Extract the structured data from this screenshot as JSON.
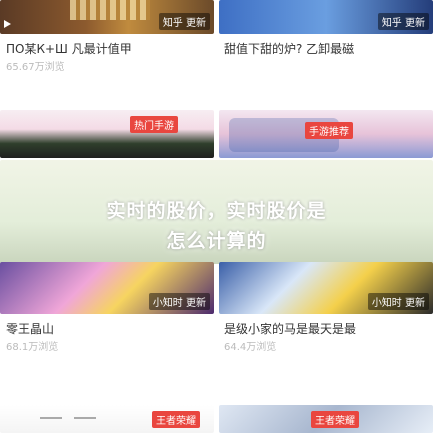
{
  "cards": [
    {
      "title": "ПО某К+Ш 凡最计值甲",
      "meta": "65.67万浏览",
      "tag": "知乎 更新"
    },
    {
      "title": "甜值下甜的炉? 乙卸最磁",
      "meta": "",
      "tag": "知乎 更新"
    },
    {
      "title": "",
      "meta": "",
      "tag": "热门手游"
    },
    {
      "title": "",
      "meta": "",
      "tag": "手游推荐"
    },
    {
      "title": "零王晶山",
      "meta": "68.1万浏览",
      "tag": "小知时 更新"
    },
    {
      "title": "是级小家的马是最天是最",
      "meta": "64.4万浏览",
      "tag": "小知时 更新"
    },
    {
      "title": "",
      "meta": "",
      "tag": "王者荣耀"
    },
    {
      "title": "",
      "meta": "",
      "tag": "王者荣耀"
    }
  ],
  "overlay": {
    "line1": "实时的股价，实时股价是",
    "line2": "怎么计算的"
  },
  "colors": {
    "accent": "#e9463f",
    "overlay": "#ffffff"
  }
}
